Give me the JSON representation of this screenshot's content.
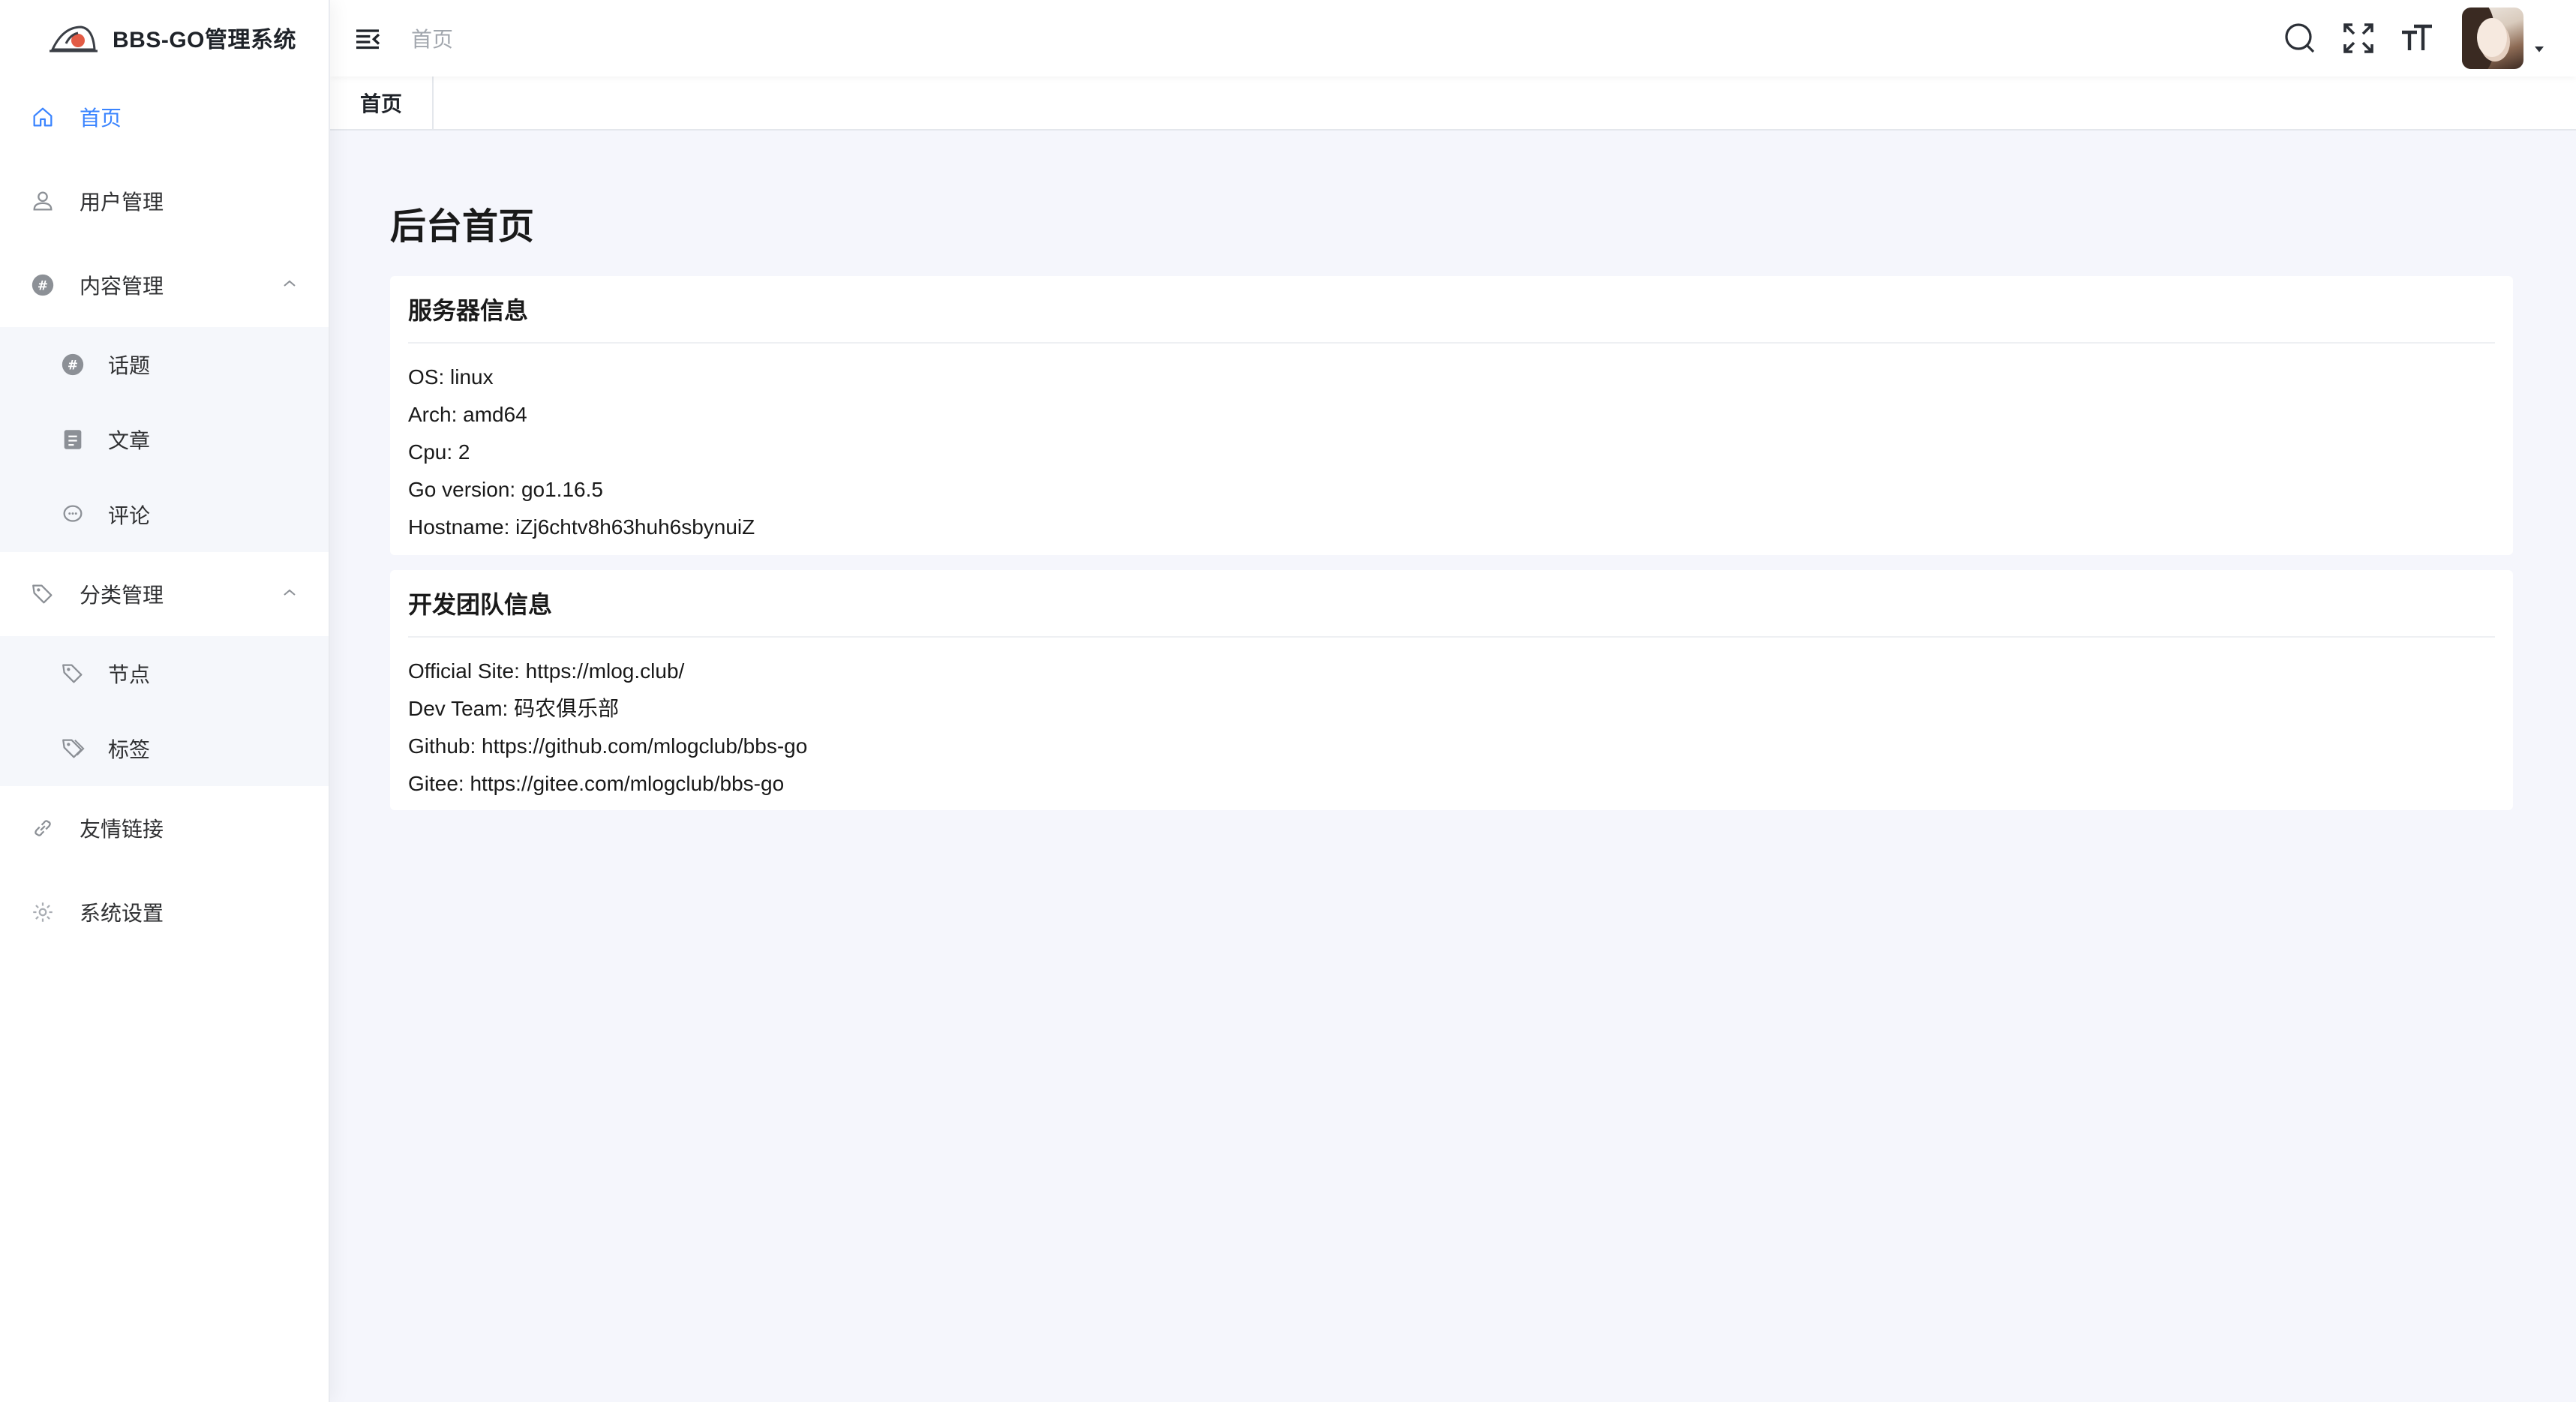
{
  "brand": {
    "title": "BBS-GO管理系统",
    "logo_icon": "bbs-go-logo-icon"
  },
  "sidebar": {
    "items": [
      {
        "label": "首页",
        "icon": "home-icon",
        "active": true
      },
      {
        "label": "用户管理",
        "icon": "user-icon"
      },
      {
        "label": "内容管理",
        "icon": "hash-icon",
        "expanded": true,
        "children": [
          {
            "label": "话题",
            "icon": "hash-icon"
          },
          {
            "label": "文章",
            "icon": "document-icon"
          },
          {
            "label": "评论",
            "icon": "comment-icon"
          }
        ]
      },
      {
        "label": "分类管理",
        "icon": "tags-icon",
        "expanded": true,
        "children": [
          {
            "label": "节点",
            "icon": "tag-icon"
          },
          {
            "label": "标签",
            "icon": "tags-icon"
          }
        ]
      },
      {
        "label": "友情链接",
        "icon": "link-icon"
      },
      {
        "label": "系统设置",
        "icon": "gear-icon"
      }
    ]
  },
  "navbar": {
    "breadcrumb": "首页",
    "icons": [
      "hamburger-icon",
      "search-icon",
      "fullscreen-icon",
      "font-size-icon",
      "caret-down-icon"
    ]
  },
  "tags": [
    {
      "label": "首页",
      "active": true
    }
  ],
  "page": {
    "title": "后台首页",
    "server_card": {
      "title": "服务器信息",
      "rows": [
        "OS: linux",
        "Arch: amd64",
        "Cpu: 2",
        "Go version: go1.16.5",
        "Hostname: iZj6chtv8h63huh6sbynuiZ"
      ]
    },
    "team_card": {
      "title": "开发团队信息",
      "rows": [
        "Official Site: https://mlog.club/",
        "Dev Team: 码农俱乐部",
        "Github: https://github.com/mlogclub/bbs-go",
        "Gitee: https://gitee.com/mlogclub/bbs-go"
      ]
    }
  },
  "colors": {
    "accent": "#3a84ff",
    "main_bg": "#f5f6fc",
    "submenu_bg": "#f5f7fb",
    "text": "#1f2329",
    "muted": "#a1a6ad"
  }
}
